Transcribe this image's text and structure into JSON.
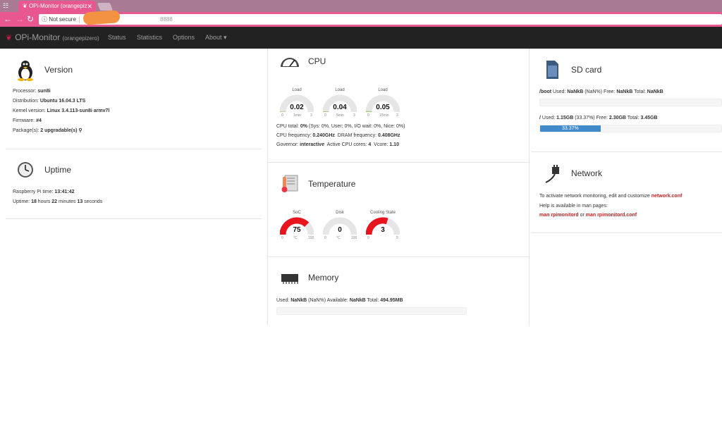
{
  "browser": {
    "tab_title": "OPi-Monitor (orangepiz",
    "tab_close": "✕",
    "security": "Not secure",
    "url": "8888"
  },
  "nav": {
    "brand": "OPi-Monitor",
    "brand_sub": "(orangepizero)",
    "items": [
      "Status",
      "Statistics",
      "Options",
      "About ▾"
    ]
  },
  "version": {
    "title": "Version",
    "processor_label": "Processor: ",
    "processor": "sun8i",
    "distribution_label": "Distribution: ",
    "distribution": "Ubuntu 16.04.3 LTS",
    "kernel_label": "Kernel version: ",
    "kernel": "Linux 3.4.113-sun8i armv7l",
    "firmware_label": "Firmware: ",
    "firmware": "#4",
    "packages_label": "Package(s): ",
    "packages": "2 upgradable(s)"
  },
  "uptime": {
    "title": "Uptime",
    "time_label": "Raspberry Pi time: ",
    "time": "13:41:42",
    "uptime_label": "Uptime: ",
    "hours": "18",
    "hours_word": " hours ",
    "minutes": "22",
    "minutes_word": " minutes ",
    "seconds": "13",
    "seconds_word": " seconds"
  },
  "cpu": {
    "title": "CPU",
    "gauges": [
      {
        "label": "Load",
        "value": "0.02",
        "min": "0",
        "mid": "1min",
        "max": "3",
        "fraction": 0.01
      },
      {
        "label": "Load",
        "value": "0.04",
        "min": "0",
        "mid": "5min",
        "max": "3",
        "fraction": 0.015
      },
      {
        "label": "Load",
        "value": "0.05",
        "min": "0",
        "mid": "15min",
        "max": "3",
        "fraction": 0.02
      }
    ],
    "total_label": "CPU total: ",
    "total": "0%",
    "total_detail": " (Sys: 0%, User: 0%, I/O wait: 0%, Nice: 0%)",
    "freq_label": "CPU frequency: ",
    "freq": "0.240GHz",
    "dram_label": "  DRAM frequency: ",
    "dram": "0.408GHz",
    "gov_label": "Governor: ",
    "gov": "interactive",
    "cores_label": "  Active CPU cores: ",
    "cores": "4",
    "vcore_label": "  Vcore: ",
    "vcore": "1.10"
  },
  "temperature": {
    "title": "Temperature",
    "gauges": [
      {
        "label": "SoC",
        "value": "75",
        "min": "0",
        "mid": "°C",
        "max": "100",
        "fraction": 0.75
      },
      {
        "label": "Disk",
        "value": "0",
        "min": "0",
        "mid": "°C",
        "max": "100",
        "fraction": 0.0
      },
      {
        "label": "Cooling State",
        "value": "3",
        "min": "0",
        "mid": "",
        "max": "5",
        "fraction": 0.6
      }
    ]
  },
  "memory": {
    "title": "Memory",
    "used_label": "Used: ",
    "used": "NaNkB",
    "used_pct": "(NaN%)",
    "avail_label": " Available: ",
    "avail": "NaNkB",
    "total_label": " Total: ",
    "total": "494.95MB"
  },
  "sdcard": {
    "title": "SD card",
    "boot_mount": "/boot",
    "boot_used_label": " Used: ",
    "boot_used": "NaNkB",
    "boot_pct": "(NaN%)",
    "boot_free_label": " Free: ",
    "boot_free": "NaNkB",
    "boot_total_label": " Total: ",
    "boot_total": "NaNkB",
    "root_mount": "/",
    "root_used_label": " Used: ",
    "root_used": "1.15GB",
    "root_pct": "(33.37%)",
    "root_free_label": " Free: ",
    "root_free": "2.30GB",
    "root_total_label": " Total: ",
    "root_total": "3.45GB",
    "root_bar_label": "33.37%",
    "root_fraction": 0.3337
  },
  "network": {
    "title": "Network",
    "line1": "To activate network monitoring, edit and customize ",
    "config_link": "network.conf",
    "line2": "Help is available in man pages:",
    "man1": "man rpimonitord",
    "or": " or ",
    "man2": "man rpimonitord.conf"
  },
  "colors": {
    "accent": "#e8578f",
    "navbar": "#222222",
    "gauge_red": "#e8141e",
    "gauge_green": "#a3c86d",
    "progress": "#428bca",
    "link": "#b22222"
  }
}
